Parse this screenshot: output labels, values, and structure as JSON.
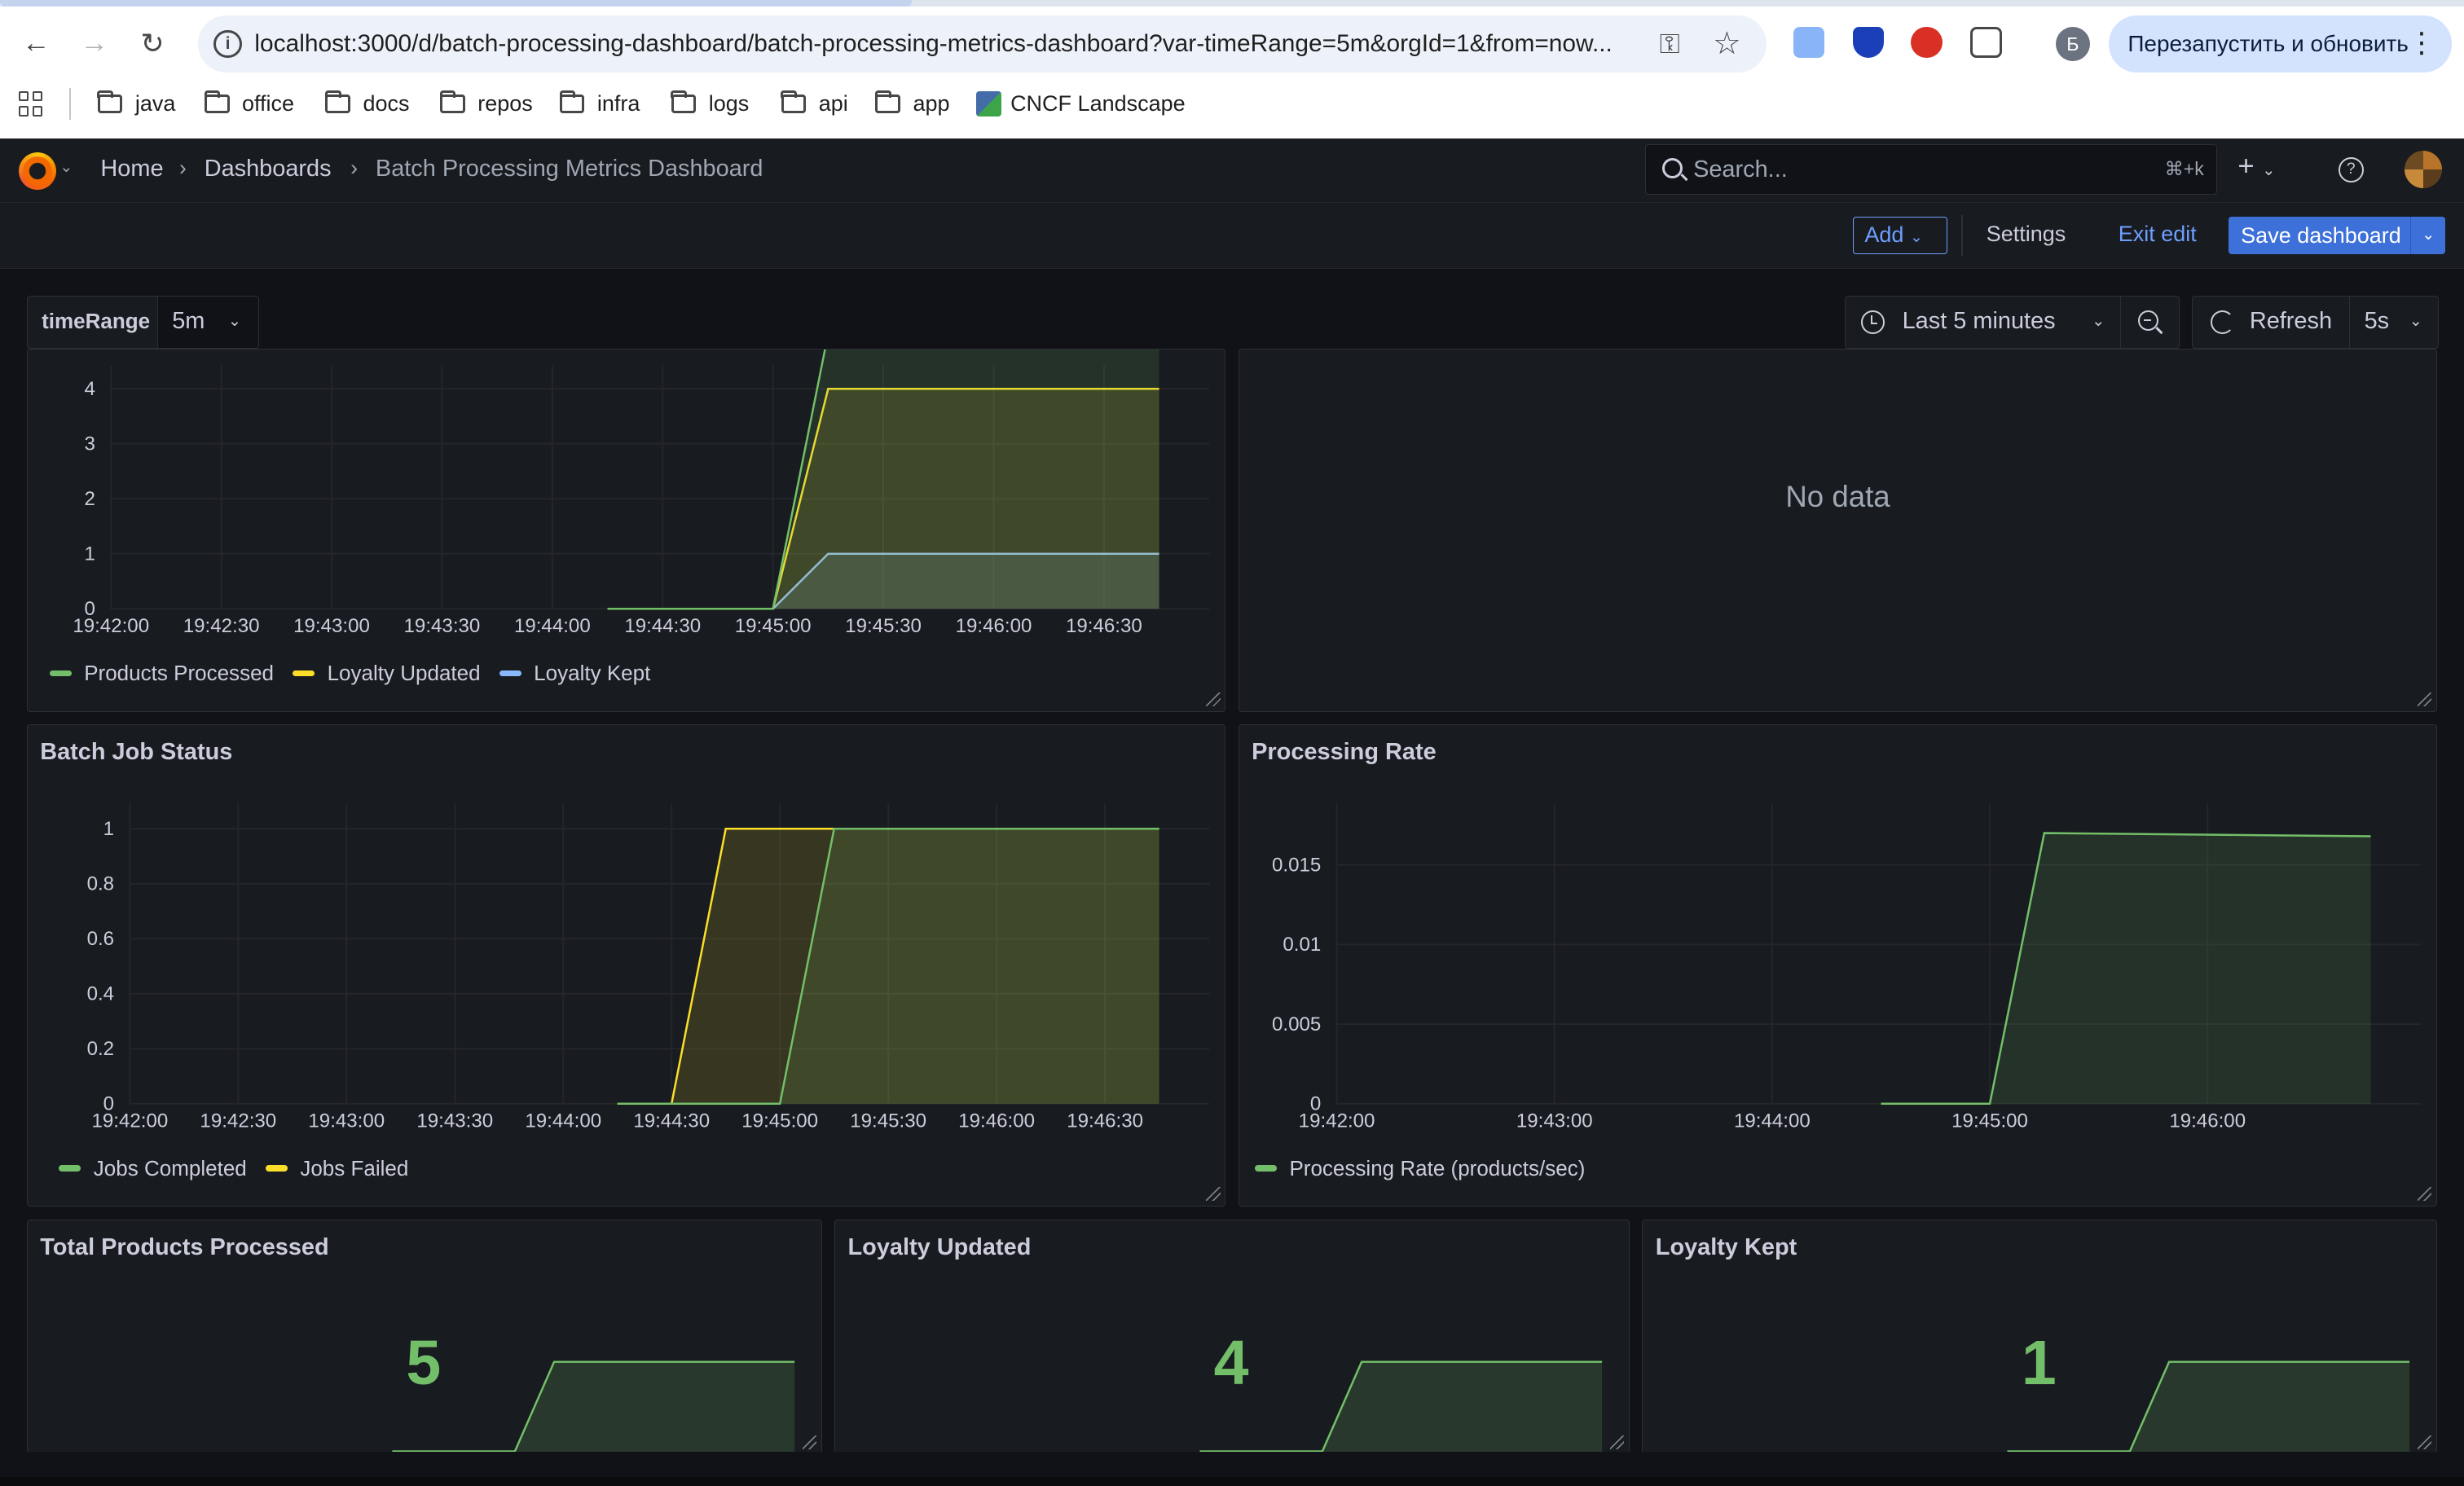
{
  "browser": {
    "url_main": "localhost:3000/d/batch-processing-dashboard/batch-processing-metrics-dashboard?var-timeRange=5m&orgId=1&from=now...",
    "profile_initial": "Б",
    "relaunch_label": "Перезапустить и обновить",
    "bookmarks": [
      "java",
      "office",
      "docs",
      "repos",
      "infra",
      "logs",
      "api",
      "app",
      "CNCF Landscape"
    ]
  },
  "grafana": {
    "breadcrumbs": [
      "Home",
      "Dashboards",
      "Batch Processing Metrics Dashboard"
    ],
    "search_placeholder": "Search...",
    "search_shortcut": "⌘+k",
    "toolbar": {
      "add_label": "Add",
      "settings_label": "Settings",
      "exit_edit_label": "Exit edit",
      "save_label": "Save dashboard"
    },
    "variables": {
      "time_range_label": "timeRange",
      "time_range_value": "5m"
    },
    "time_picker_label": "Last 5 minutes",
    "refresh_label": "Refresh",
    "refresh_interval": "5s"
  },
  "colors": {
    "green": "#73bf69",
    "yellow": "#fade2a",
    "blue": "#8ab8ff",
    "background": "#111217",
    "panel": "#181b1f"
  },
  "panels": {
    "top_right": {
      "message": "No data"
    },
    "batch_job_status": {
      "title": "Batch Job Status"
    },
    "processing_rate": {
      "title": "Processing Rate"
    },
    "stats": [
      {
        "title": "Total Products Processed",
        "value": "5"
      },
      {
        "title": "Loyalty Updated",
        "value": "4"
      },
      {
        "title": "Loyalty Kept",
        "value": "1"
      }
    ]
  },
  "chart_data": [
    {
      "type": "area",
      "title": "",
      "x": [
        "19:42:00",
        "19:42:30",
        "19:43:00",
        "19:43:30",
        "19:44:00",
        "19:44:30",
        "19:45:00",
        "19:45:30",
        "19:46:00",
        "19:46:30"
      ],
      "y_ticks": [
        "0",
        "1",
        "2",
        "3",
        "4"
      ],
      "series": [
        {
          "name": "Products Processed",
          "color": "#73bf69",
          "points": [
            [
              "19:44:15",
              0
            ],
            [
              "19:45:00",
              0
            ],
            [
              "19:45:15",
              5
            ],
            [
              "19:46:45",
              5
            ]
          ]
        },
        {
          "name": "Loyalty Updated",
          "color": "#fade2a",
          "points": [
            [
              "19:44:15",
              0
            ],
            [
              "19:45:00",
              0
            ],
            [
              "19:45:15",
              4
            ],
            [
              "19:46:45",
              4
            ]
          ]
        },
        {
          "name": "Loyalty Kept",
          "color": "#8ab8ff",
          "points": [
            [
              "19:44:15",
              0
            ],
            [
              "19:45:00",
              0
            ],
            [
              "19:45:15",
              1
            ],
            [
              "19:46:45",
              1
            ]
          ]
        }
      ]
    },
    {
      "type": "area",
      "title": "Batch Job Status",
      "x": [
        "19:42:00",
        "19:42:30",
        "19:43:00",
        "19:43:30",
        "19:44:00",
        "19:44:30",
        "19:45:00",
        "19:45:30",
        "19:46:00",
        "19:46:30"
      ],
      "y_ticks": [
        "0",
        "0.2",
        "0.4",
        "0.6",
        "0.8",
        "1"
      ],
      "series": [
        {
          "name": "Jobs Completed",
          "color": "#73bf69",
          "points": [
            [
              "19:44:15",
              0
            ],
            [
              "19:45:00",
              0
            ],
            [
              "19:45:15",
              1
            ],
            [
              "19:46:45",
              1
            ]
          ]
        },
        {
          "name": "Jobs Failed",
          "color": "#fade2a",
          "points": [
            [
              "19:44:15",
              0
            ],
            [
              "19:44:30",
              0
            ],
            [
              "19:44:45",
              1
            ],
            [
              "19:46:45",
              1
            ]
          ]
        }
      ]
    },
    {
      "type": "area",
      "title": "Processing Rate",
      "x": [
        "19:42:00",
        "19:43:00",
        "19:44:00",
        "19:45:00",
        "19:46:00"
      ],
      "y_ticks": [
        "0",
        "0.005",
        "0.01",
        "0.015"
      ],
      "series": [
        {
          "name": "Processing Rate (products/sec)",
          "color": "#73bf69",
          "points": [
            [
              "19:44:30",
              0
            ],
            [
              "19:45:00",
              0
            ],
            [
              "19:45:15",
              0.017
            ],
            [
              "19:46:45",
              0.0168
            ]
          ]
        }
      ]
    }
  ]
}
